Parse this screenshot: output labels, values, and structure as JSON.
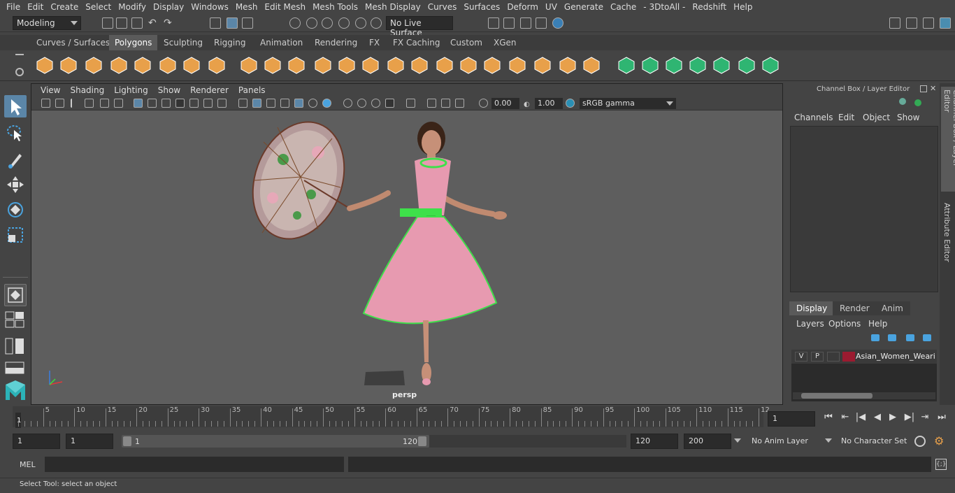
{
  "menu": [
    "File",
    "Edit",
    "Create",
    "Select",
    "Modify",
    "Display",
    "Windows",
    "Mesh",
    "Edit Mesh",
    "Mesh Tools",
    "Mesh Display",
    "Curves",
    "Surfaces",
    "Deform",
    "UV",
    "Generate",
    "Cache",
    "- 3DtoAll -",
    "Redshift",
    "Help"
  ],
  "status": {
    "mode": "Modeling",
    "live_surface": "No Live Surface"
  },
  "shelf_tabs": [
    "Curves / Surfaces",
    "Polygons",
    "Sculpting",
    "Rigging",
    "Animation",
    "Rendering",
    "FX",
    "FX Caching",
    "Custom",
    "XGen"
  ],
  "shelf_active": "Polygons",
  "viewport": {
    "menu": [
      "View",
      "Shading",
      "Lighting",
      "Show",
      "Renderer",
      "Panels"
    ],
    "exposure": "0.00",
    "gamma": "1.00",
    "color_space": "sRGB gamma",
    "camera_label": "persp"
  },
  "right_panel": {
    "title": "Channel Box / Layer Editor",
    "menu": [
      "Channels",
      "Edit",
      "Object",
      "Show"
    ],
    "display_tabs": [
      "Display",
      "Render",
      "Anim"
    ],
    "layer_menu": [
      "Layers",
      "Options",
      "Help"
    ],
    "layer": {
      "v": "V",
      "p": "P",
      "name": "Asian_Women_Wearin",
      "color": "#9b1b30"
    }
  },
  "side_tabs": [
    "Channel Box / Layer Editor",
    "Attribute Editor"
  ],
  "timeline": {
    "ticks": [
      "5",
      "10",
      "15",
      "20",
      "25",
      "30",
      "35",
      "40",
      "45",
      "50",
      "55",
      "60",
      "65",
      "70",
      "75",
      "80",
      "85",
      "90",
      "95",
      "100",
      "105",
      "110",
      "115",
      "12"
    ],
    "start_label": "1",
    "current_frame": "1"
  },
  "range": {
    "start": "1",
    "playback_start": "1",
    "slider_start": "1",
    "slider_end": "120",
    "playback_end": "120",
    "end": "200",
    "anim_layer": "No Anim Layer",
    "char_set": "No Character Set"
  },
  "cmd": {
    "lang": "MEL"
  },
  "help_line": "Select Tool: select an object",
  "colors": {
    "accent_teal": "#2bb3b8",
    "shelf_orange": "#e8a04a",
    "shelf_green": "#2fb572",
    "dress_pink": "#e79ab0",
    "sash_green": "#3ee04a"
  }
}
